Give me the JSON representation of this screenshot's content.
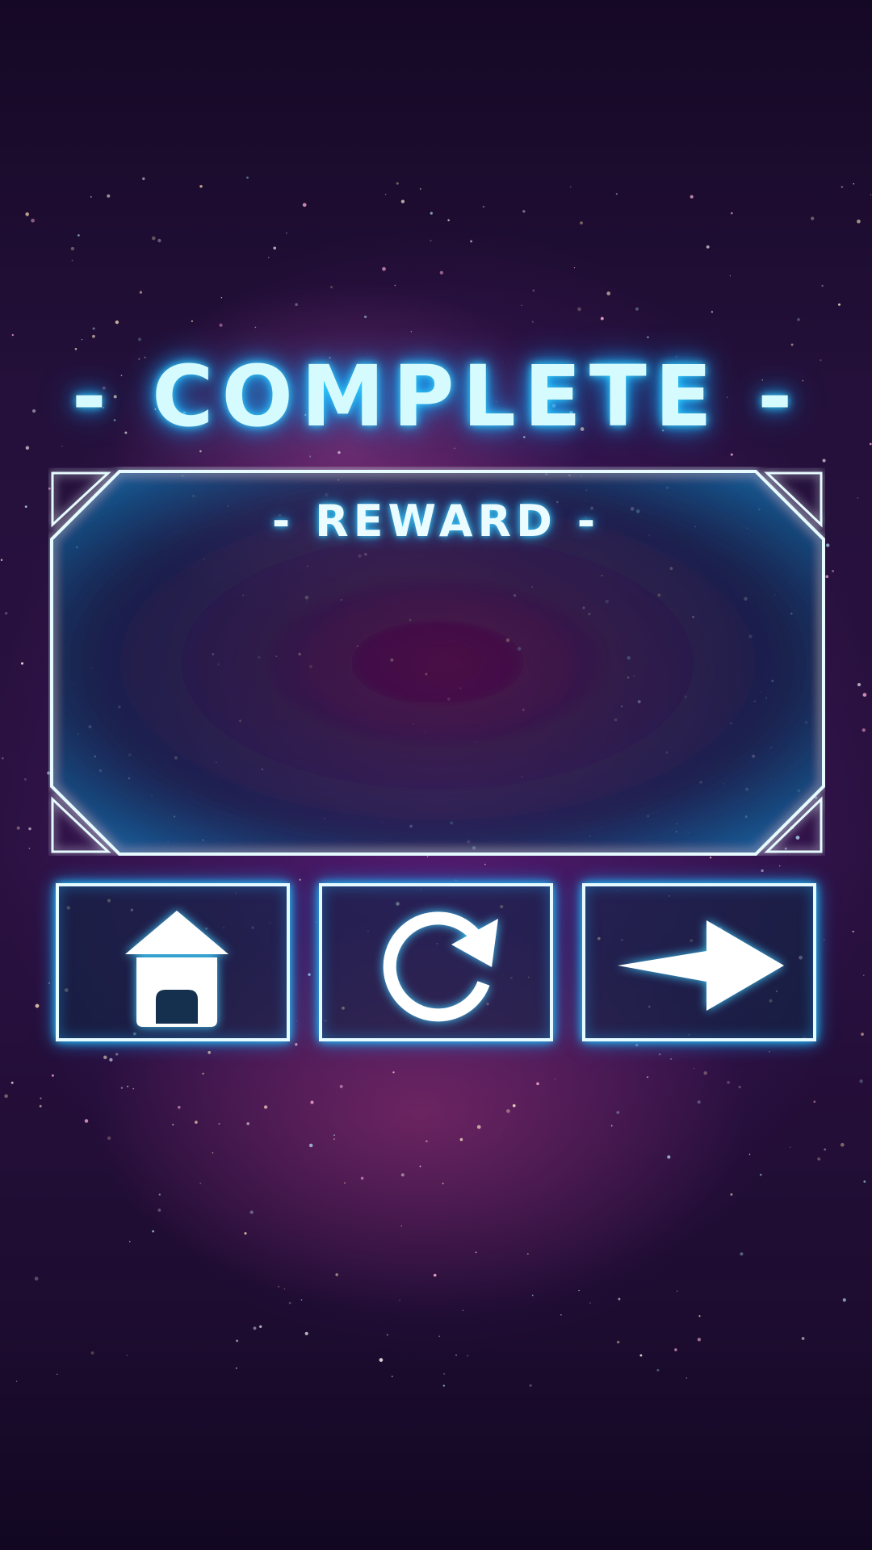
{
  "screen": {
    "title": "- COMPLETE -",
    "reward_panel": {
      "title": "- REWARD -"
    },
    "buttons": [
      {
        "id": "home",
        "icon": "home-icon"
      },
      {
        "id": "retry",
        "icon": "restart-icon"
      },
      {
        "id": "next",
        "icon": "arrow-right-icon"
      }
    ]
  },
  "colors": {
    "neon_cyan": "#39d8ff",
    "text_light": "#d6fbff",
    "background_purple": "#2b1142"
  }
}
